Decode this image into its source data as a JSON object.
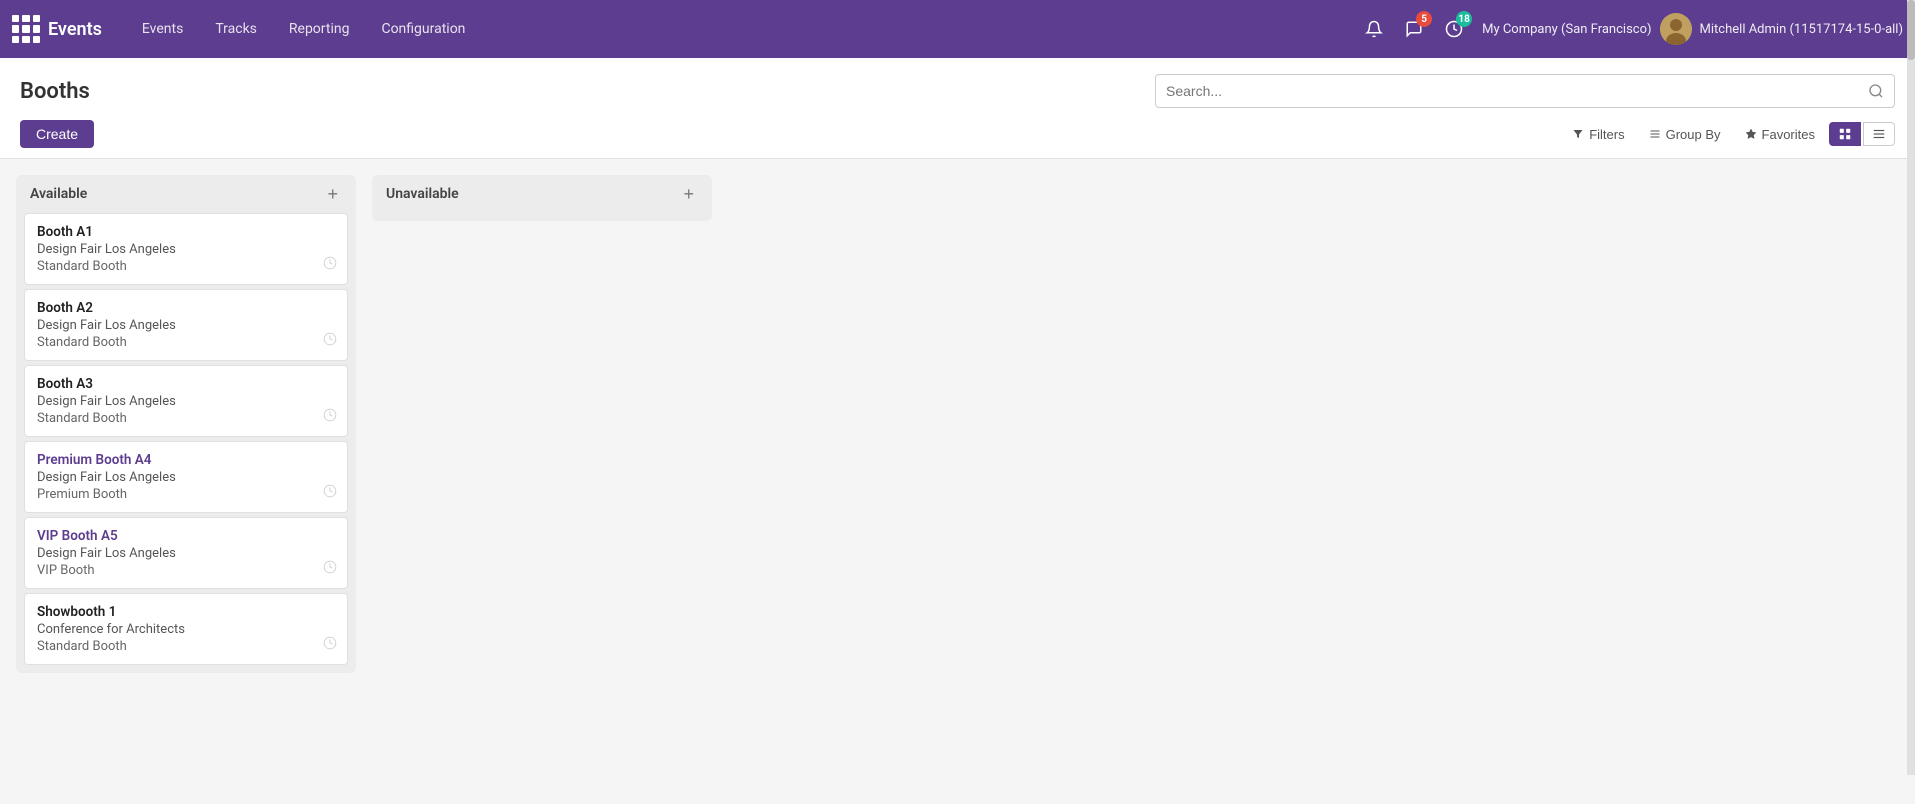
{
  "topnav": {
    "app_name": "Events",
    "menu_items": [
      "Events",
      "Tracks",
      "Reporting",
      "Configuration"
    ],
    "notification_icon": "bell",
    "chat_badge": "5",
    "timer_badge": "18",
    "company": "My Company (San Francisco)",
    "user": "Mitchell Admin (11517174-15-0-all)"
  },
  "page": {
    "title": "Booths",
    "search_placeholder": "Search..."
  },
  "toolbar": {
    "create_label": "Create",
    "filters_label": "Filters",
    "group_by_label": "Group By",
    "favorites_label": "Favorites"
  },
  "columns": [
    {
      "id": "available",
      "title": "Available",
      "cards": [
        {
          "name": "Booth A1",
          "event": "Design Fair Los Angeles",
          "type": "Standard Booth",
          "name_style": "normal"
        },
        {
          "name": "Booth A2",
          "event": "Design Fair Los Angeles",
          "type": "Standard Booth",
          "name_style": "normal"
        },
        {
          "name": "Booth A3",
          "event": "Design Fair Los Angeles",
          "type": "Standard Booth",
          "name_style": "normal"
        },
        {
          "name": "Premium Booth A4",
          "event": "Design Fair Los Angeles",
          "type": "Premium Booth",
          "name_style": "purple"
        },
        {
          "name": "VIP Booth A5",
          "event": "Design Fair Los Angeles",
          "type": "VIP Booth",
          "name_style": "purple"
        },
        {
          "name": "Showbooth 1",
          "event": "Conference for Architects",
          "type": "Standard Booth",
          "name_style": "normal"
        }
      ]
    },
    {
      "id": "unavailable",
      "title": "Unavailable",
      "cards": []
    }
  ]
}
